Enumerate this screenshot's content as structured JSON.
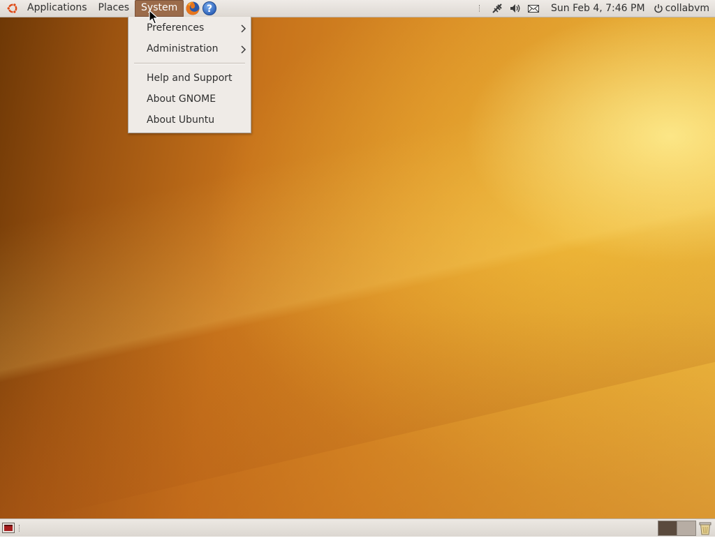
{
  "top_panel": {
    "menus": {
      "applications": "Applications",
      "places": "Places",
      "system": "System"
    },
    "launchers": [
      "firefox-icon",
      "help-icon"
    ],
    "tray_icons": [
      "network-icon",
      "volume-icon",
      "mail-icon"
    ],
    "clock": "Sun Feb  4,  7:46 PM",
    "user": "collabvm"
  },
  "system_menu": {
    "items": [
      {
        "label": "Preferences",
        "submenu": true
      },
      {
        "label": "Administration",
        "submenu": true
      },
      {
        "label": "Help and Support",
        "submenu": false
      },
      {
        "label": "About GNOME",
        "submenu": false
      },
      {
        "label": "About Ubuntu",
        "submenu": false
      }
    ]
  },
  "bottom_panel": {
    "workspaces": 2,
    "active_workspace": 1
  },
  "colors": {
    "panel_bg": "#efebe7",
    "menu_active": "#9b6b4a",
    "wallpaper_primary": "#d98c25"
  }
}
